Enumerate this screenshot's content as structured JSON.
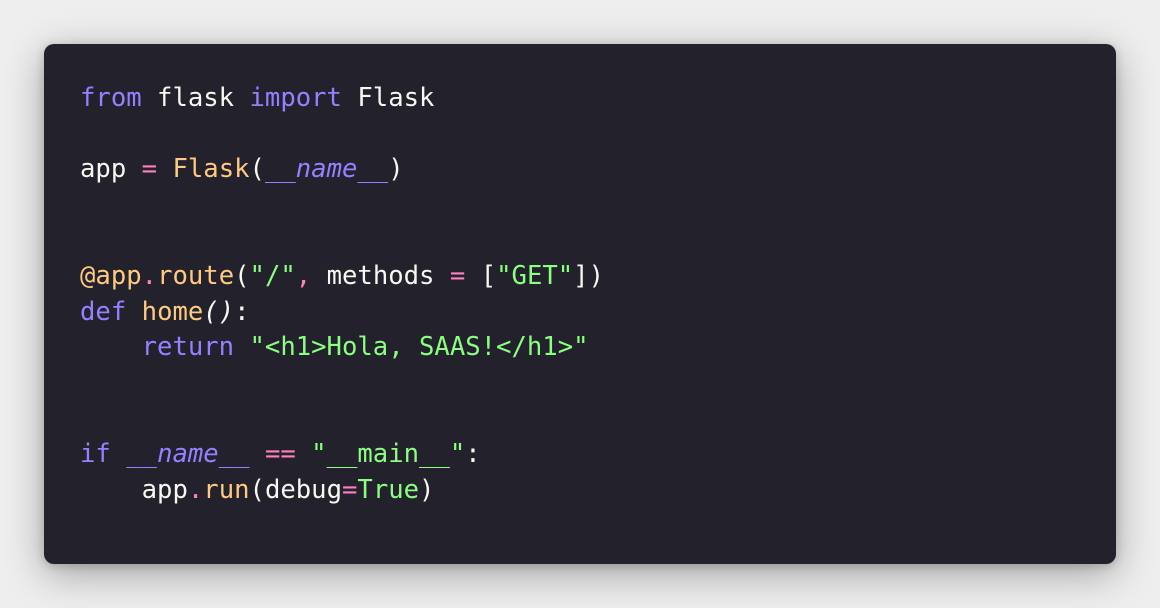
{
  "theme": {
    "background": "#22212c",
    "keyword": "#9580ff",
    "function": "#ffca80",
    "string": "#8aff80",
    "text": "#f8f8f2",
    "operator": "#ff80bf"
  },
  "code": {
    "line1": {
      "t1": "from",
      "t2": " flask ",
      "t3": "import",
      "t4": " Flask"
    },
    "line2": {
      "t1": "app",
      "t2": " = ",
      "t3": "Flask",
      "t4": "(",
      "t5": "__name__",
      "t6": ")"
    },
    "line3": {
      "t1": "@app",
      "t2": ".",
      "t3": "route",
      "t4": "(",
      "t5": "\"/\"",
      "t6": ", ",
      "t7": "methods",
      "t8": " = ",
      "t9": "[",
      "t10": "\"GET\"",
      "t11": "])"
    },
    "line4": {
      "t1": "def",
      "t2": " ",
      "t3": "home",
      "t4": "()",
      "t5": ":"
    },
    "line5": {
      "t1": "    ",
      "t2": "return",
      "t3": " ",
      "t4": "\"<h1>Hola, SAAS!</h1>\""
    },
    "line6": {
      "t1": "if",
      "t2": " ",
      "t3": "__name__",
      "t4": " == ",
      "t5": "\"__main__\"",
      "t6": ":"
    },
    "line7": {
      "t1": "    app",
      "t2": ".",
      "t3": "run",
      "t4": "(debug",
      "t5": "=",
      "t6": "True",
      "t7": ")"
    }
  }
}
